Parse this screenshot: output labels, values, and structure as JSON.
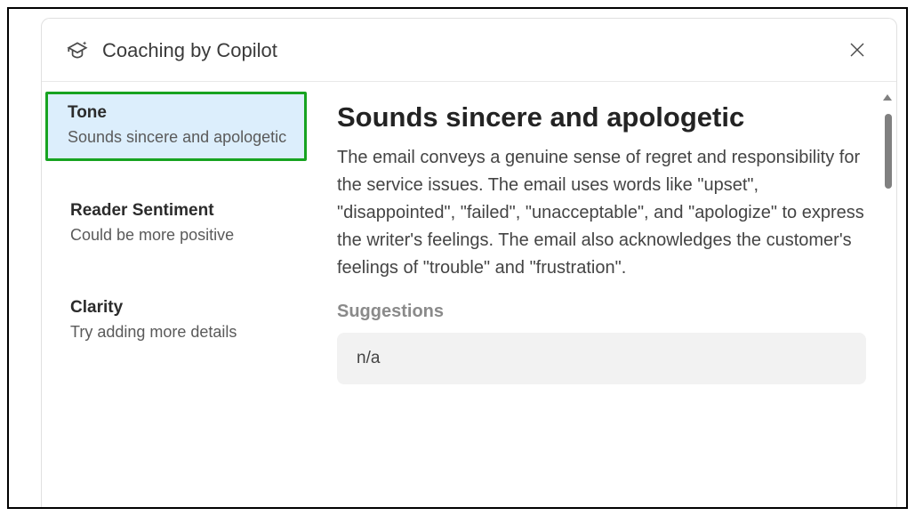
{
  "header": {
    "title": "Coaching by Copilot"
  },
  "sidebar": {
    "items": [
      {
        "title": "Tone",
        "subtitle": "Sounds sincere and apologetic",
        "selected": true
      },
      {
        "title": "Reader Sentiment",
        "subtitle": "Could be more positive",
        "selected": false
      },
      {
        "title": "Clarity",
        "subtitle": "Try adding more details",
        "selected": false
      }
    ]
  },
  "content": {
    "title": "Sounds sincere and apologetic",
    "body": "The email conveys a genuine sense of regret and responsibility for the service issues. The email uses words like \"upset\", \"disappointed\", \"failed\", \"unacceptable\", and \"apologize\" to express the writer's feelings. The email also acknowledges the customer's feelings of \"trouble\" and \"frustration\".",
    "suggestions_label": "Suggestions",
    "suggestion": "n/a"
  }
}
